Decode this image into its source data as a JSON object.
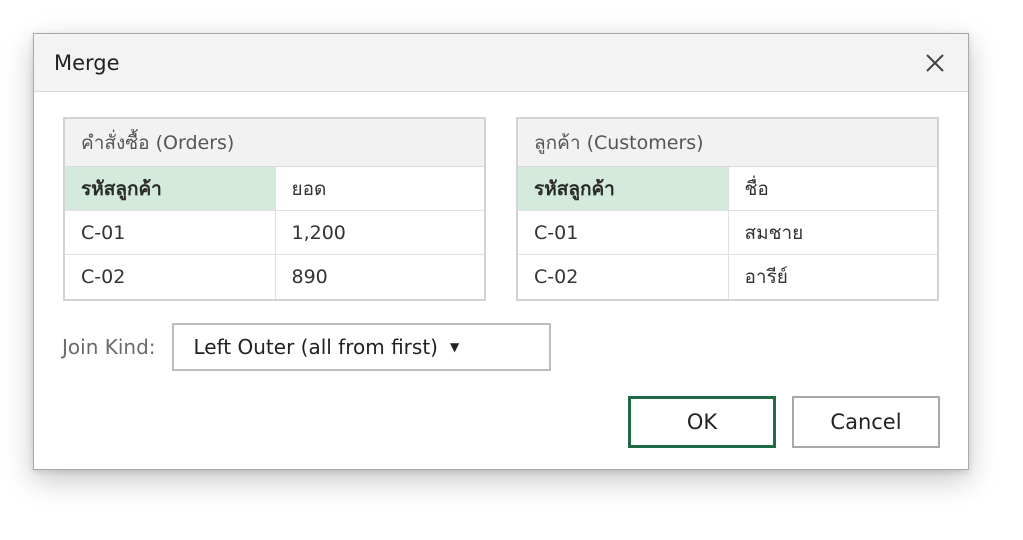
{
  "dialog": {
    "title": "Merge"
  },
  "orders_table": {
    "caption": "คำสั่งซื้อ (Orders)",
    "headers": [
      "รหัสลูกค้า",
      "ยอด"
    ],
    "rows": [
      [
        "C-01",
        "1,200"
      ],
      [
        "C-02",
        "890"
      ]
    ]
  },
  "customers_table": {
    "caption": "ลูกค้า (Customers)",
    "headers": [
      "รหัสลูกค้า",
      "ชื่อ"
    ],
    "rows": [
      [
        "C-01",
        "สมชาย"
      ],
      [
        "C-02",
        "อารีย์"
      ]
    ]
  },
  "join": {
    "label": "Join Kind:",
    "selected": "Left Outer (all from first)"
  },
  "buttons": {
    "ok_label": "OK",
    "cancel_label": "Cancel"
  },
  "colors": {
    "key_column": "#d3eadd",
    "ok_border": "#1e6b45"
  },
  "icons": {
    "close": "close-icon",
    "dropdown": "caret-down-icon"
  }
}
